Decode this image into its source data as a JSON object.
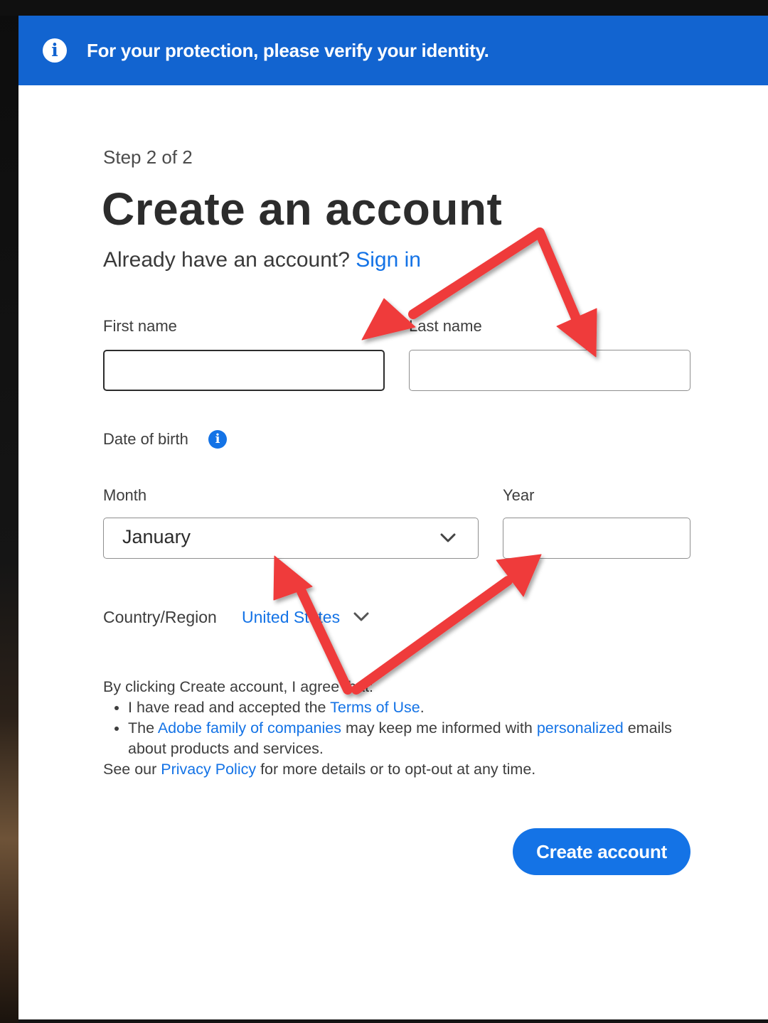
{
  "banner": {
    "icon": "info-icon",
    "text": "For your protection, please verify your identity."
  },
  "form": {
    "step": "Step 2 of 2",
    "title": "Create an account",
    "already_text": "Already have an account?",
    "sign_in": "Sign in",
    "first_name_label": "First name",
    "first_name_value": "",
    "last_name_label": "Last name",
    "last_name_value": "",
    "dob_label": "Date of birth",
    "dob_info_icon": "info-icon",
    "month_label": "Month",
    "month_value": "January",
    "year_label": "Year",
    "year_value": "",
    "country_label": "Country/Region",
    "country_value": "United States"
  },
  "legal": {
    "intro": "By clicking Create account, I agree that:",
    "item1_pre": "I have read and accepted the ",
    "item1_link": "Terms of Use",
    "item1_post": ".",
    "item2_pre": "The ",
    "item2_link1": "Adobe family of companies",
    "item2_mid": " may keep me informed with ",
    "item2_link2": "personalized",
    "item2_post": " emails about products and services.",
    "footer_pre": "See our ",
    "footer_link": "Privacy Policy",
    "footer_post": " for more details or to opt-out at any time."
  },
  "button": {
    "create": "Create account"
  },
  "colors": {
    "accent": "#1473e6",
    "banner": "#1264d0",
    "annotation_arrow": "#ef3b3b"
  }
}
